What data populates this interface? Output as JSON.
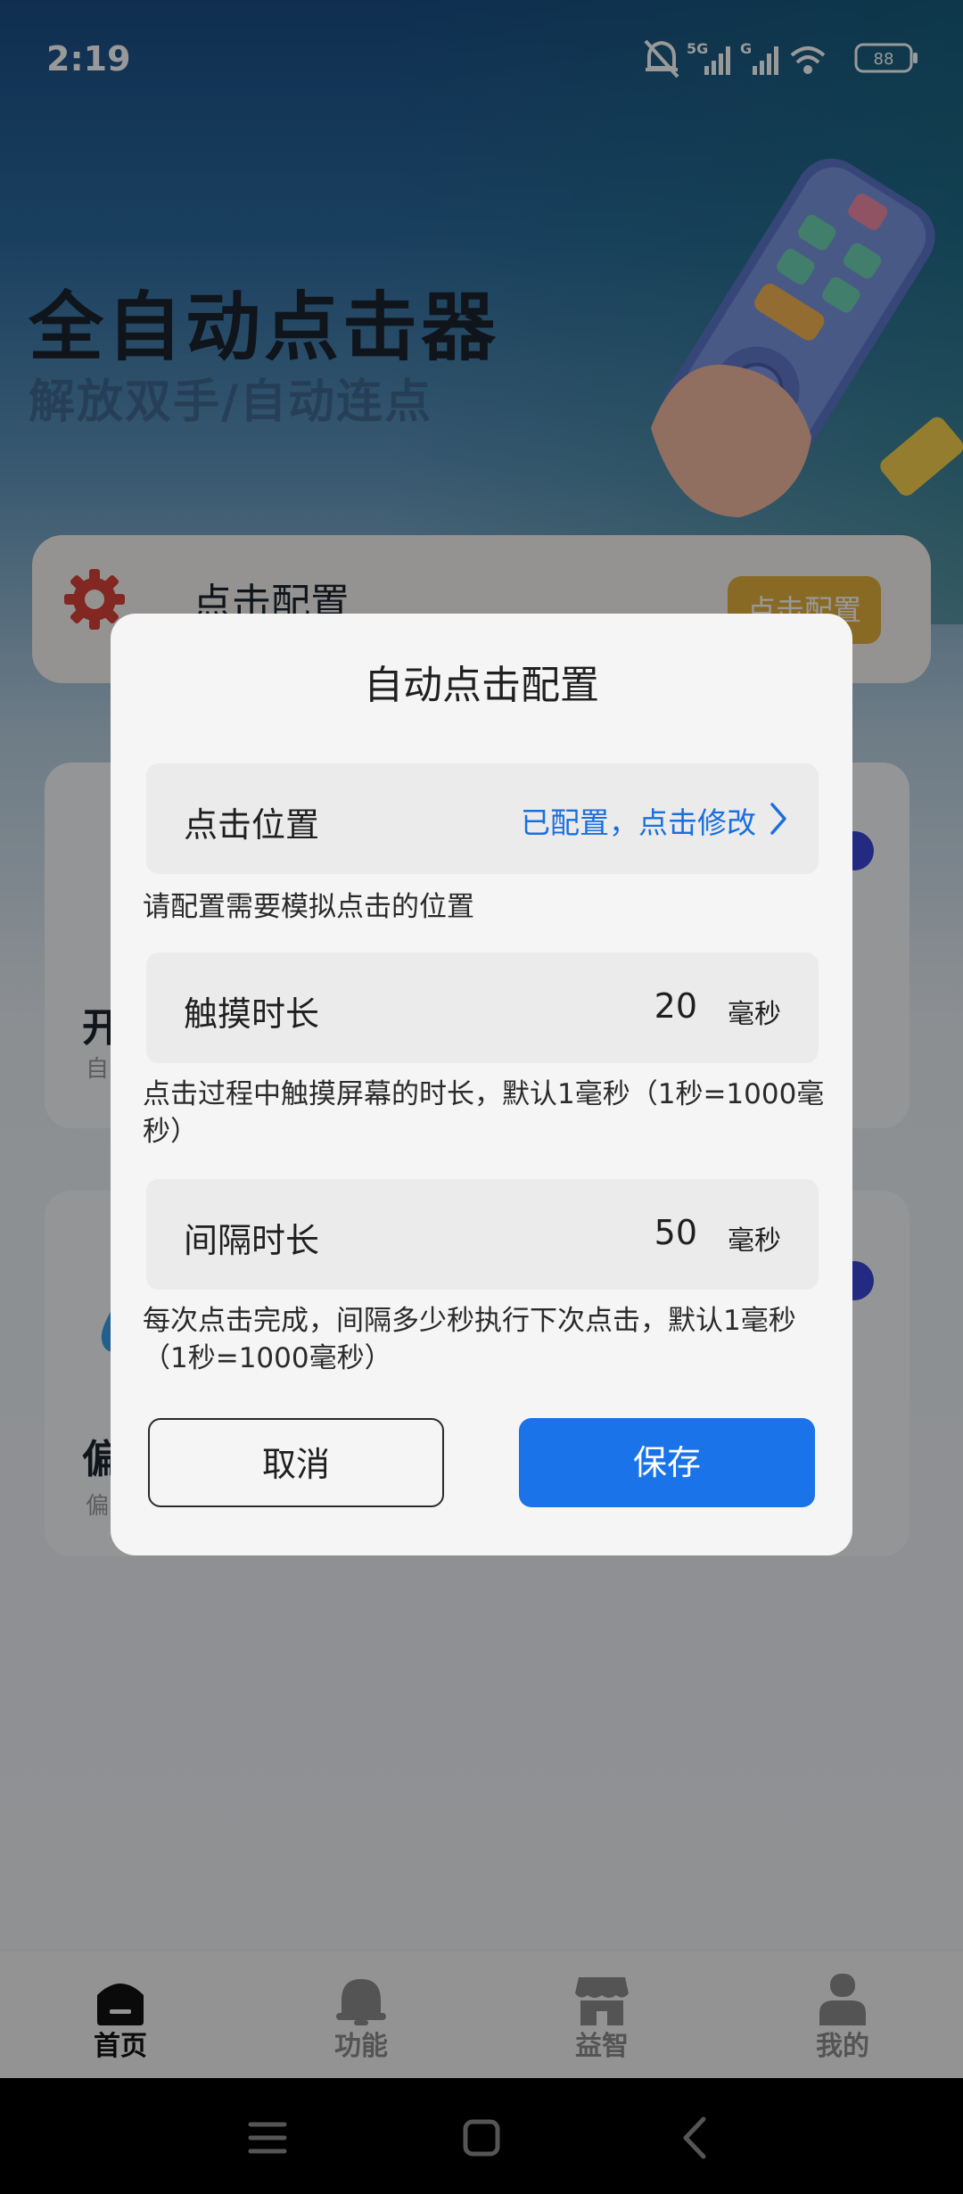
{
  "status_bar": {
    "time": "2:19",
    "battery": "88",
    "network_labels": [
      "5G",
      "G"
    ]
  },
  "hero": {
    "title": "全自动点击器",
    "subtitle": "解放双手/自动连点"
  },
  "config_card": {
    "label": "点击配置",
    "button": "点击配置"
  },
  "feature_cards": [
    {
      "title": "开",
      "sub": "自"
    },
    {
      "title": "偏",
      "sub": "偏"
    }
  ],
  "dialog": {
    "title": "自动点击配置",
    "position_row": {
      "label": "点击位置",
      "value": "已配置，点击修改"
    },
    "position_hint": "请配置需要模拟点击的位置",
    "touch_row": {
      "label": "触摸时长",
      "value": "20",
      "unit": "毫秒"
    },
    "touch_hint": "点击过程中触摸屏幕的时长，默认1毫秒（1秒=1000毫秒）",
    "interval_row": {
      "label": "间隔时长",
      "value": "50",
      "unit": "毫秒"
    },
    "interval_hint": "每次点击完成，间隔多少秒执行下次点击，默认1毫秒（1秒=1000毫秒）",
    "cancel": "取消",
    "save": "保存"
  },
  "bottom_nav": [
    {
      "label": "首页",
      "icon": "home-icon",
      "active": true
    },
    {
      "label": "功能",
      "icon": "bell-icon",
      "active": false
    },
    {
      "label": "益智",
      "icon": "store-icon",
      "active": false
    },
    {
      "label": "我的",
      "icon": "user-icon",
      "active": false
    }
  ],
  "colors": {
    "primary": "#1a73e8",
    "link": "#1a6fe0",
    "gear": "#d9423a",
    "accent": "#e3b13c"
  }
}
